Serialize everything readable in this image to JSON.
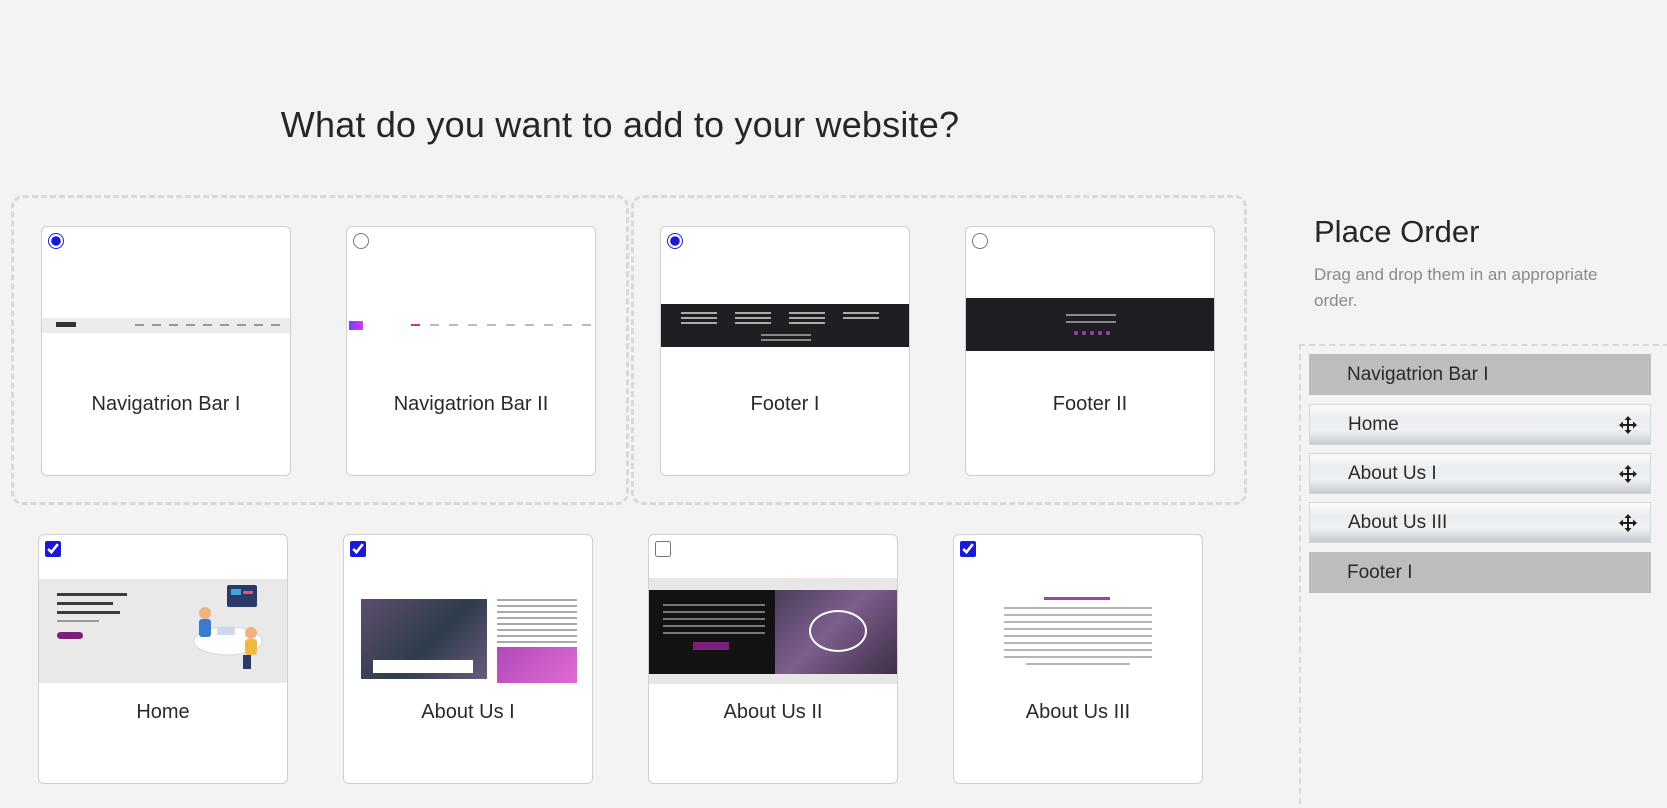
{
  "heading": "What do you want to add to your website?",
  "options": {
    "nav1": {
      "label": "Navigatrion Bar I",
      "selected": true,
      "input": "radio"
    },
    "nav2": {
      "label": "Navigatrion Bar II",
      "selected": false,
      "input": "radio"
    },
    "footer1": {
      "label": "Footer I",
      "selected": true,
      "input": "radio"
    },
    "footer2": {
      "label": "Footer II",
      "selected": false,
      "input": "radio"
    },
    "home": {
      "label": "Home",
      "selected": true,
      "input": "checkbox"
    },
    "about1": {
      "label": "About Us I",
      "selected": true,
      "input": "checkbox"
    },
    "about2": {
      "label": "About Us II",
      "selected": false,
      "input": "checkbox"
    },
    "about3": {
      "label": "About Us III",
      "selected": true,
      "input": "checkbox"
    }
  },
  "place_order": {
    "title": "Place Order",
    "subtitle": "Drag and drop them in an appropriate order.",
    "items": [
      {
        "label": "Navigatrion Bar I",
        "draggable": false
      },
      {
        "label": "Home",
        "draggable": true
      },
      {
        "label": "About Us I",
        "draggable": true
      },
      {
        "label": "About Us III",
        "draggable": true
      },
      {
        "label": "Footer I",
        "draggable": false
      }
    ]
  },
  "colors": {
    "accent": "#1a1ad6",
    "background": "#f3f3f3",
    "fixed_item": "#bdbdbd",
    "brand_purple": "#7a1f7a"
  }
}
